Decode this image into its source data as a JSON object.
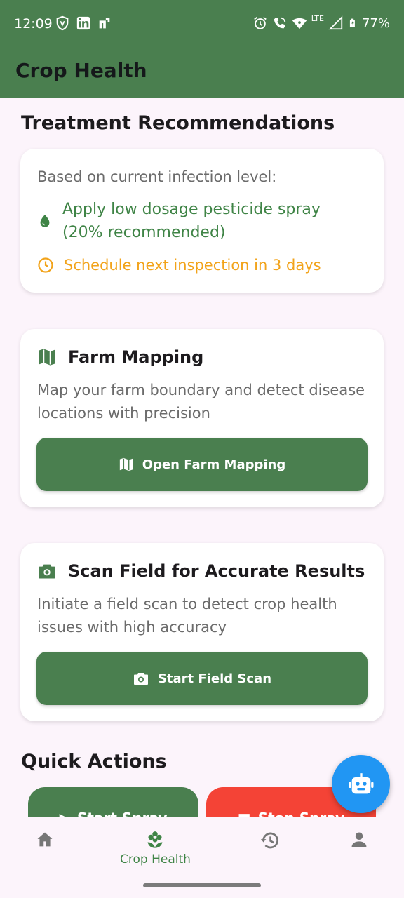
{
  "status_bar": {
    "time": "12:09",
    "battery": "77%",
    "network": "LTE"
  },
  "app_bar": {
    "title": "Crop Health"
  },
  "treatment": {
    "title": "Treatment Recommendations",
    "intro": "Based on current infection level:",
    "recommendation_1": "Apply low dosage pesticide spray (20% recommended)",
    "recommendation_2": "Schedule next inspection in 3 days"
  },
  "farm_mapping": {
    "title": "Farm Mapping",
    "description": "Map your farm boundary and detect disease locations with precision",
    "button_label": "Open Farm Mapping"
  },
  "field_scan": {
    "title": "Scan Field for Accurate Results",
    "description": "Initiate a field scan to detect crop health issues with high accuracy",
    "button_label": "Start Field Scan"
  },
  "quick_actions": {
    "title": "Quick Actions",
    "start_spray": "Start Spray",
    "stop_spray": "Stop Spray"
  },
  "bottom_nav": {
    "items": [
      {
        "icon": "home-icon",
        "label": ""
      },
      {
        "icon": "flower-icon",
        "label": "Crop Health",
        "active": true
      },
      {
        "icon": "history-icon",
        "label": ""
      },
      {
        "icon": "person-icon",
        "label": ""
      }
    ]
  },
  "colors": {
    "primary": "#4a7f4f",
    "accent_green": "#3f8446",
    "warning_orange": "#f2a31a",
    "stop_red": "#f44336",
    "fab_blue": "#2196f3",
    "background": "#fcf4fb"
  }
}
